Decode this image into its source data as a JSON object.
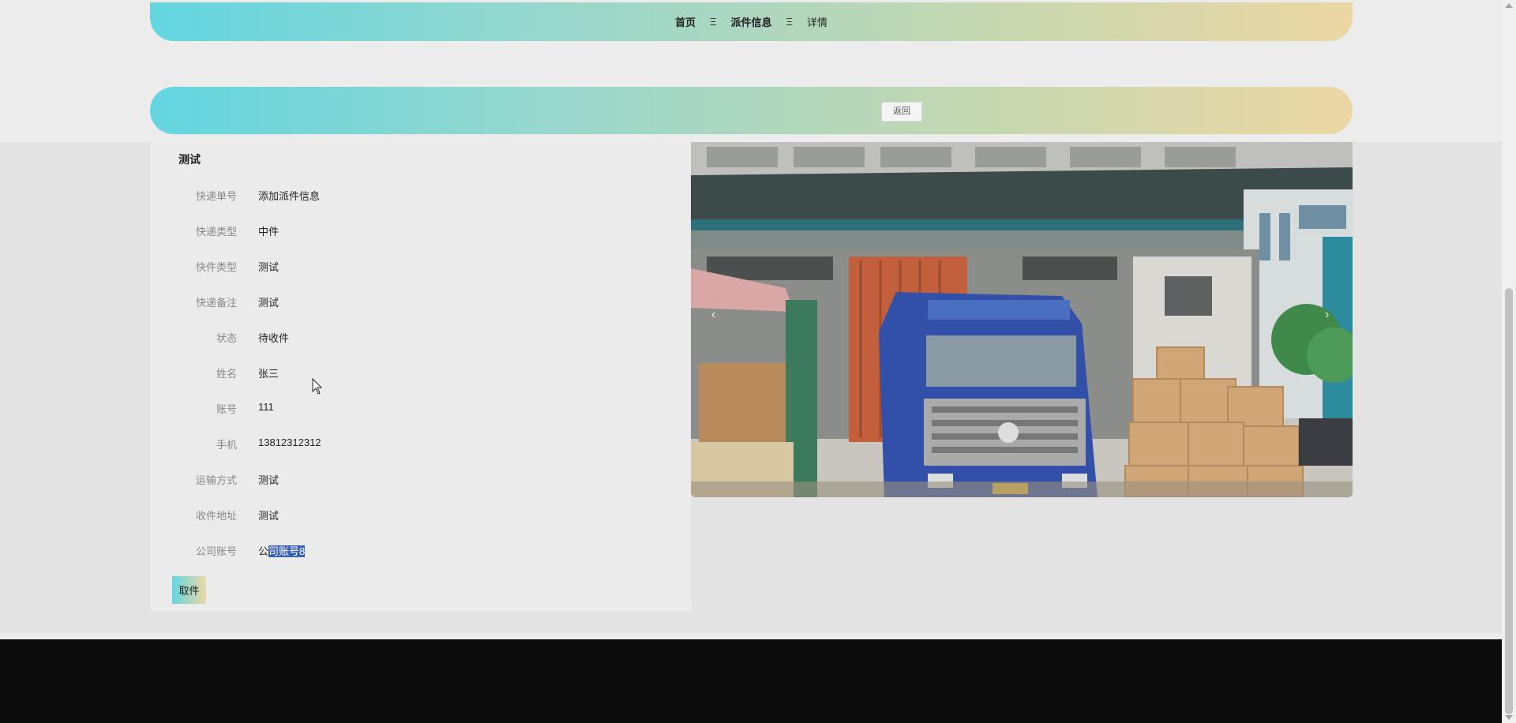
{
  "breadcrumb": {
    "home": "首页",
    "section": "派件信息",
    "current": "详情",
    "separator": "Ξ"
  },
  "actions": {
    "back_label": "返回"
  },
  "detail": {
    "title": "测试",
    "fields": [
      {
        "label": "快递单号",
        "value": "添加派件信息"
      },
      {
        "label": "快递类型",
        "value": "中件"
      },
      {
        "label": "快件类型",
        "value": "测试"
      },
      {
        "label": "快递备注",
        "value": "测试"
      },
      {
        "label": "状态",
        "value": "待收件"
      },
      {
        "label": "姓名",
        "value": "张三"
      },
      {
        "label": "账号",
        "value": "111"
      },
      {
        "label": "手机",
        "value": "13812312312"
      },
      {
        "label": "运输方式",
        "value": "测试"
      },
      {
        "label": "收件地址",
        "value": "测试"
      },
      {
        "label": "公司账号",
        "value_prefix": "公",
        "value_selected": "司账号8"
      }
    ],
    "pickup_label": "取件"
  },
  "carousel": {
    "prev_icon": "‹",
    "next_icon": "›"
  },
  "colors": {
    "gradient_start": "#63d6e0",
    "gradient_end": "#ecd7a4",
    "selection": "#3a5fb3",
    "footer": "#0c0c0c"
  }
}
